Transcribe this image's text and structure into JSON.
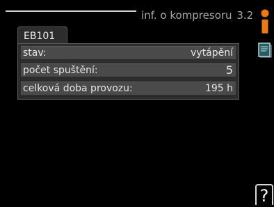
{
  "header": {
    "title": "inf. o kompresoru",
    "menu_number": "3.2"
  },
  "tab": {
    "label": "EB101"
  },
  "rows": [
    {
      "label": "stav:",
      "value": "vytápění"
    },
    {
      "label": "počet spuštění:",
      "value": "5"
    },
    {
      "label": "celková doba provozu:",
      "value": "195 h"
    }
  ],
  "icons": {
    "info": "info-icon",
    "manual": "book-icon",
    "help": "help-icon",
    "help_glyph": "?"
  },
  "colors": {
    "background": "#000000",
    "panel": "#2d2d2d",
    "row": "#4a4a4a",
    "info_icon": "#f07a10"
  }
}
